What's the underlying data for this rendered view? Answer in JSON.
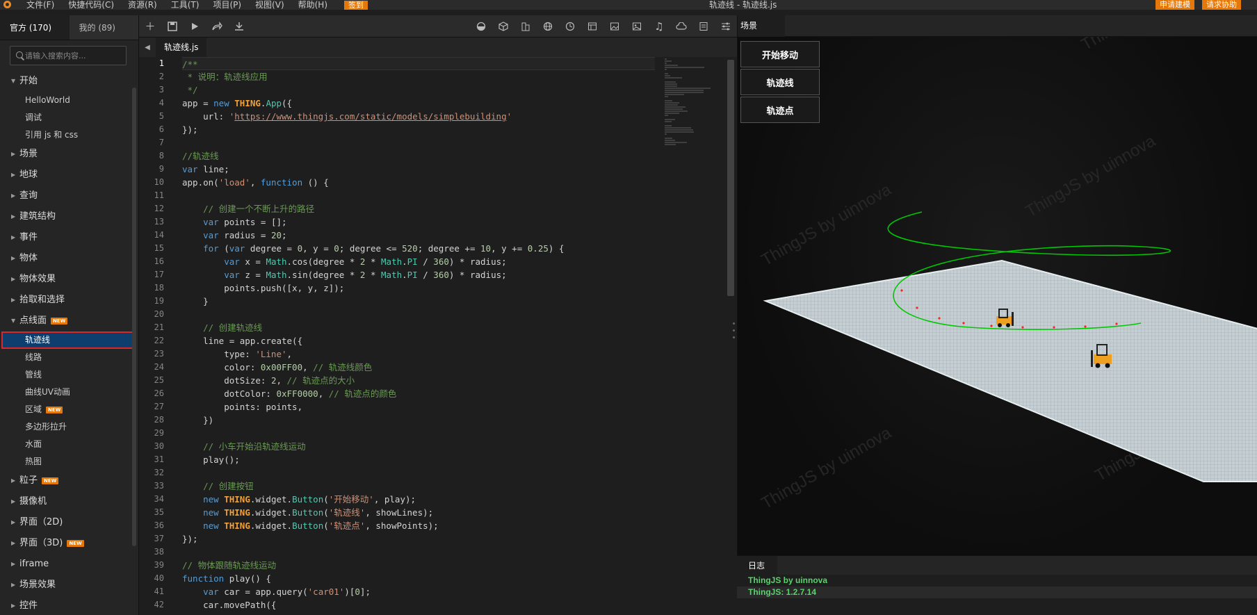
{
  "menubar": {
    "items": [
      "文件(F)",
      "快捷代码(C)",
      "资源(R)",
      "工具(T)",
      "项目(P)",
      "视图(V)",
      "帮助(H)"
    ],
    "signin": "签到",
    "title": "轨迹线 -  轨迹线.js",
    "apply_modeling": "申请建模",
    "request_help": "请求协助"
  },
  "left": {
    "tab_official": "官方 (170)",
    "tab_mine": "我的 (89)",
    "search_placeholder": "请输入搜索内容...",
    "new_badge": "NEW",
    "tree": [
      {
        "kind": "cat",
        "label": "开始",
        "expanded": true
      },
      {
        "kind": "leaf",
        "label": "HelloWorld"
      },
      {
        "kind": "leaf",
        "label": "调试"
      },
      {
        "kind": "leaf",
        "label": "引用 js 和 css"
      },
      {
        "kind": "cat",
        "label": "场景"
      },
      {
        "kind": "cat",
        "label": "地球"
      },
      {
        "kind": "cat",
        "label": "查询"
      },
      {
        "kind": "cat",
        "label": "建筑结构"
      },
      {
        "kind": "cat",
        "label": "事件"
      },
      {
        "kind": "cat",
        "label": "物体"
      },
      {
        "kind": "cat",
        "label": "物体效果"
      },
      {
        "kind": "cat",
        "label": "拾取和选择"
      },
      {
        "kind": "cat",
        "label": "点线面",
        "expanded": true,
        "badge": true
      },
      {
        "kind": "leaf",
        "label": "轨迹线",
        "selected": true
      },
      {
        "kind": "leaf",
        "label": "线路"
      },
      {
        "kind": "leaf",
        "label": "管线"
      },
      {
        "kind": "leaf",
        "label": "曲线UV动画"
      },
      {
        "kind": "leaf",
        "label": "区域",
        "badge": true
      },
      {
        "kind": "leaf",
        "label": "多边形拉升"
      },
      {
        "kind": "leaf",
        "label": "水面"
      },
      {
        "kind": "leaf",
        "label": "热图"
      },
      {
        "kind": "cat",
        "label": "粒子",
        "badge": true
      },
      {
        "kind": "cat",
        "label": "摄像机"
      },
      {
        "kind": "cat",
        "label": "界面（2D)"
      },
      {
        "kind": "cat",
        "label": "界面（3D)",
        "badge": true
      },
      {
        "kind": "cat",
        "label": "iframe"
      },
      {
        "kind": "cat",
        "label": "场景效果"
      },
      {
        "kind": "cat",
        "label": "控件"
      }
    ]
  },
  "editor": {
    "file_tab": "轨迹线.js",
    "current_line": 1,
    "lines": [
      [
        [
          "cm",
          "/**"
        ]
      ],
      [
        [
          "cm",
          " * 说明：轨迹线应用"
        ]
      ],
      [
        [
          "cm",
          " */"
        ]
      ],
      [
        [
          "",
          "app = "
        ],
        [
          "kw",
          "new "
        ],
        [
          "cls",
          "THING"
        ],
        [
          "",
          "."
        ],
        [
          "prop",
          "App"
        ],
        [
          "",
          "({"
        ]
      ],
      [
        [
          "",
          "    url: "
        ],
        [
          "str",
          "'"
        ],
        [
          "url",
          "https://www.thingjs.com/static/models/simplebuilding"
        ],
        [
          "str",
          "'"
        ]
      ],
      [
        [
          "",
          "});"
        ]
      ],
      [
        [
          "",
          ""
        ]
      ],
      [
        [
          "cm",
          "//轨迹线"
        ]
      ],
      [
        [
          "kw",
          "var "
        ],
        [
          "",
          "line;"
        ]
      ],
      [
        [
          "",
          "app.on("
        ],
        [
          "str",
          "'load'"
        ],
        [
          "",
          ", "
        ],
        [
          "kw",
          "function "
        ],
        [
          "",
          "() {"
        ]
      ],
      [
        [
          "",
          ""
        ]
      ],
      [
        [
          "",
          "    "
        ],
        [
          "cm",
          "// 创建一个不断上升的路径"
        ]
      ],
      [
        [
          "",
          "    "
        ],
        [
          "kw",
          "var "
        ],
        [
          "",
          "points = [];"
        ]
      ],
      [
        [
          "",
          "    "
        ],
        [
          "kw",
          "var "
        ],
        [
          "",
          "radius = "
        ],
        [
          "num",
          "20"
        ],
        [
          "",
          ";"
        ]
      ],
      [
        [
          "",
          "    "
        ],
        [
          "kw",
          "for "
        ],
        [
          "",
          "("
        ],
        [
          "kw",
          "var "
        ],
        [
          "",
          "degree = "
        ],
        [
          "num",
          "0"
        ],
        [
          "",
          ", y = "
        ],
        [
          "num",
          "0"
        ],
        [
          "",
          "; degree <= "
        ],
        [
          "num",
          "520"
        ],
        [
          "",
          "; degree += "
        ],
        [
          "num",
          "10"
        ],
        [
          "",
          ", y += "
        ],
        [
          "num",
          "0.25"
        ],
        [
          "",
          ") {"
        ]
      ],
      [
        [
          "",
          "        "
        ],
        [
          "kw",
          "var "
        ],
        [
          "",
          "x = "
        ],
        [
          "prop",
          "Math"
        ],
        [
          "",
          ".cos(degree * "
        ],
        [
          "num",
          "2"
        ],
        [
          "",
          " * "
        ],
        [
          "prop",
          "Math"
        ],
        [
          "",
          "."
        ],
        [
          "prop",
          "PI"
        ],
        [
          "",
          " / "
        ],
        [
          "num",
          "360"
        ],
        [
          "",
          ") * radius;"
        ]
      ],
      [
        [
          "",
          "        "
        ],
        [
          "kw",
          "var "
        ],
        [
          "",
          "z = "
        ],
        [
          "prop",
          "Math"
        ],
        [
          "",
          ".sin(degree * "
        ],
        [
          "num",
          "2"
        ],
        [
          "",
          " * "
        ],
        [
          "prop",
          "Math"
        ],
        [
          "",
          "."
        ],
        [
          "prop",
          "PI"
        ],
        [
          "",
          " / "
        ],
        [
          "num",
          "360"
        ],
        [
          "",
          ") * radius;"
        ]
      ],
      [
        [
          "",
          "        points.push([x, y, z]);"
        ]
      ],
      [
        [
          "",
          "    }"
        ]
      ],
      [
        [
          "",
          ""
        ]
      ],
      [
        [
          "",
          "    "
        ],
        [
          "cm",
          "// 创建轨迹线"
        ]
      ],
      [
        [
          "",
          "    line = app.create({"
        ]
      ],
      [
        [
          "",
          "        type: "
        ],
        [
          "str",
          "'Line'"
        ],
        [
          "",
          ","
        ]
      ],
      [
        [
          "",
          "        color: "
        ],
        [
          "num",
          "0x00FF00"
        ],
        [
          "",
          ", "
        ],
        [
          "cm",
          "// 轨迹线颜色"
        ]
      ],
      [
        [
          "",
          "        dotSize: "
        ],
        [
          "num",
          "2"
        ],
        [
          "",
          ", "
        ],
        [
          "cm",
          "// 轨迹点的大小"
        ]
      ],
      [
        [
          "",
          "        dotColor: "
        ],
        [
          "num",
          "0xFF0000"
        ],
        [
          "",
          ", "
        ],
        [
          "cm",
          "// 轨迹点的颜色"
        ]
      ],
      [
        [
          "",
          "        points: points,"
        ]
      ],
      [
        [
          "",
          "    })"
        ]
      ],
      [
        [
          "",
          ""
        ]
      ],
      [
        [
          "",
          "    "
        ],
        [
          "cm",
          "// 小车开始沿轨迹线运动"
        ]
      ],
      [
        [
          "",
          "    play();"
        ]
      ],
      [
        [
          "",
          ""
        ]
      ],
      [
        [
          "",
          "    "
        ],
        [
          "cm",
          "// 创建按钮"
        ]
      ],
      [
        [
          "",
          "    "
        ],
        [
          "kw",
          "new "
        ],
        [
          "cls",
          "THING"
        ],
        [
          "",
          ".widget."
        ],
        [
          "prop",
          "Button"
        ],
        [
          "",
          "("
        ],
        [
          "str",
          "'开始移动'"
        ],
        [
          "",
          ", play);"
        ]
      ],
      [
        [
          "",
          "    "
        ],
        [
          "kw",
          "new "
        ],
        [
          "cls",
          "THING"
        ],
        [
          "",
          ".widget."
        ],
        [
          "prop",
          "Button"
        ],
        [
          "",
          "("
        ],
        [
          "str",
          "'轨迹线'"
        ],
        [
          "",
          ", showLines);"
        ]
      ],
      [
        [
          "",
          "    "
        ],
        [
          "kw",
          "new "
        ],
        [
          "cls",
          "THING"
        ],
        [
          "",
          ".widget."
        ],
        [
          "prop",
          "Button"
        ],
        [
          "",
          "("
        ],
        [
          "str",
          "'轨迹点'"
        ],
        [
          "",
          ", showPoints);"
        ]
      ],
      [
        [
          "",
          "});"
        ]
      ],
      [
        [
          "",
          ""
        ]
      ],
      [
        [
          "cm",
          "// 物体跟随轨迹线运动"
        ]
      ],
      [
        [
          "kw",
          "function "
        ],
        [
          "",
          "play() {"
        ]
      ],
      [
        [
          "",
          "    "
        ],
        [
          "kw",
          "var "
        ],
        [
          "",
          "car = app.query("
        ],
        [
          "str",
          "'car01'"
        ],
        [
          "",
          ")["
        ],
        [
          "num",
          "0"
        ],
        [
          "",
          "];"
        ]
      ],
      [
        [
          "",
          "    car.movePath({"
        ]
      ]
    ]
  },
  "scene": {
    "tab": "场景",
    "buttons": [
      "开始移动",
      "轨迹线",
      "轨迹点"
    ],
    "watermark": "ThingJS by uinnova",
    "colors": {
      "trail": "#00c800",
      "dot": "#ff0000",
      "floor": "#c9d2d6",
      "forklift": "#f0a020"
    }
  },
  "log": {
    "tab": "日志",
    "lines": [
      "ThingJS by uinnova",
      "ThingJS: 1.2.7.14"
    ]
  }
}
